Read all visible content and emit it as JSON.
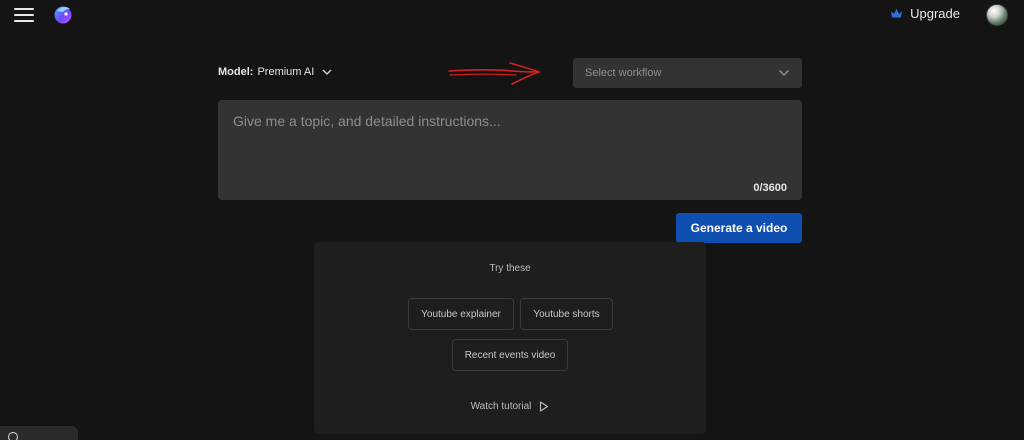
{
  "header": {
    "menu_icon": "hamburger-menu-icon",
    "logo_icon": "brand-logo-icon",
    "upgrade_icon": "crown-icon",
    "upgrade_label": "Upgrade",
    "avatar_icon": "user-avatar"
  },
  "composer": {
    "model_prefix": "Model:",
    "model_value": "Premium AI",
    "workflow_placeholder": "Select workflow",
    "prompt_placeholder": "Give me a topic, and detailed instructions...",
    "prompt_value": "",
    "char_count": "0/3600",
    "generate_label": "Generate a video"
  },
  "suggestions": {
    "title": "Try these",
    "chips": [
      {
        "label": "Youtube explainer"
      },
      {
        "label": "Youtube shorts"
      },
      {
        "label": "Recent events video"
      }
    ],
    "tutorial_label": "Watch tutorial"
  },
  "colors": {
    "background": "#141414",
    "surface": "#333333",
    "panel": "#1e1e1e",
    "accent": "#0f4fb0",
    "crown": "#2f6fd6",
    "annotation": "#d42020"
  }
}
